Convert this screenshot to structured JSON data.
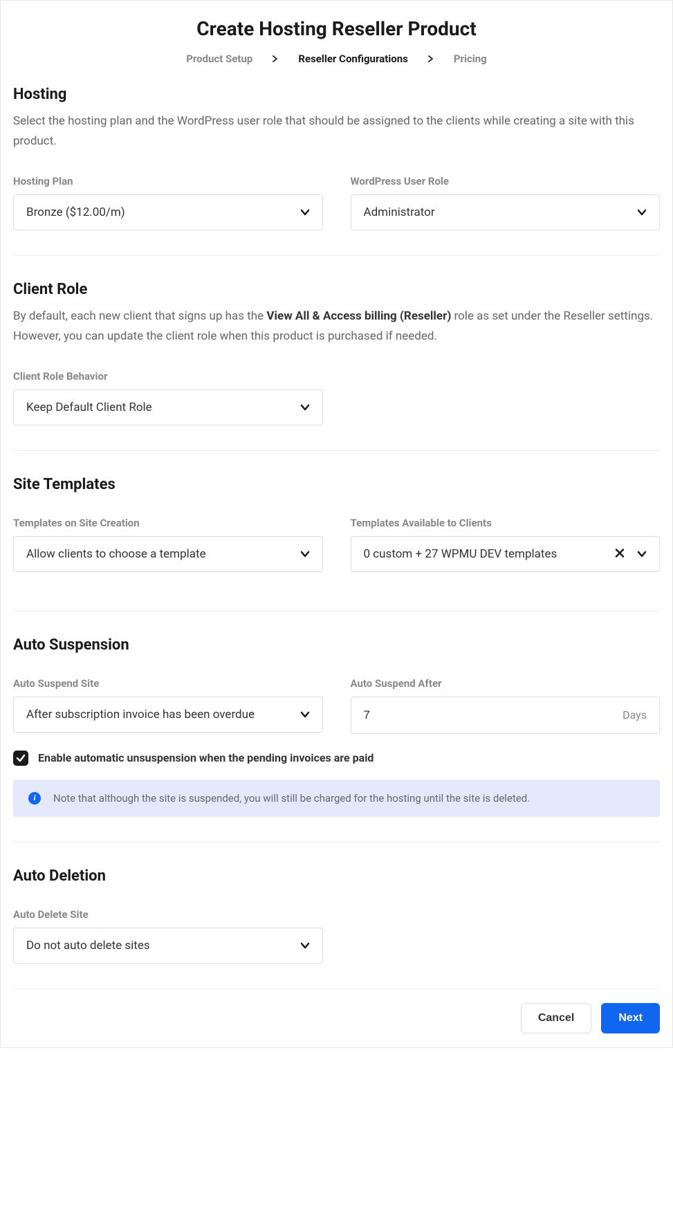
{
  "page_title": "Create Hosting Reseller Product",
  "breadcrumb": {
    "step1": "Product Setup",
    "step2": "Reseller Configurations",
    "step3": "Pricing"
  },
  "hosting": {
    "title": "Hosting",
    "desc": "Select the hosting plan and the WordPress user role that should be assigned to the clients while creating a site with this product.",
    "plan_label": "Hosting Plan",
    "plan_value": "Bronze ($12.00/m)",
    "role_label": "WordPress User Role",
    "role_value": "Administrator"
  },
  "client_role": {
    "title": "Client Role",
    "desc_pre": "By default, each new client that signs up has the ",
    "desc_bold": "View All & Access billing (Reseller)",
    "desc_post": " role as set under the Reseller settings. However, you can update the client role when this product is purchased if needed.",
    "behavior_label": "Client Role Behavior",
    "behavior_value": "Keep Default Client Role"
  },
  "site_templates": {
    "title": "Site Templates",
    "creation_label": "Templates on Site Creation",
    "creation_value": "Allow clients to choose a template",
    "available_label": "Templates Available to Clients",
    "available_value": "0 custom + 27 WPMU DEV templates"
  },
  "auto_suspension": {
    "title": "Auto Suspension",
    "suspend_label": "Auto Suspend Site",
    "suspend_value": "After subscription invoice has been overdue",
    "after_label": "Auto Suspend After",
    "after_value": "7",
    "after_unit": "Days",
    "checkbox_label": "Enable automatic unsuspension when the pending invoices are paid",
    "note": "Note that although the site is suspended, you will still be charged for the hosting until the site is deleted."
  },
  "auto_deletion": {
    "title": "Auto Deletion",
    "delete_label": "Auto Delete Site",
    "delete_value": "Do not auto delete sites"
  },
  "footer": {
    "cancel": "Cancel",
    "next": "Next"
  }
}
